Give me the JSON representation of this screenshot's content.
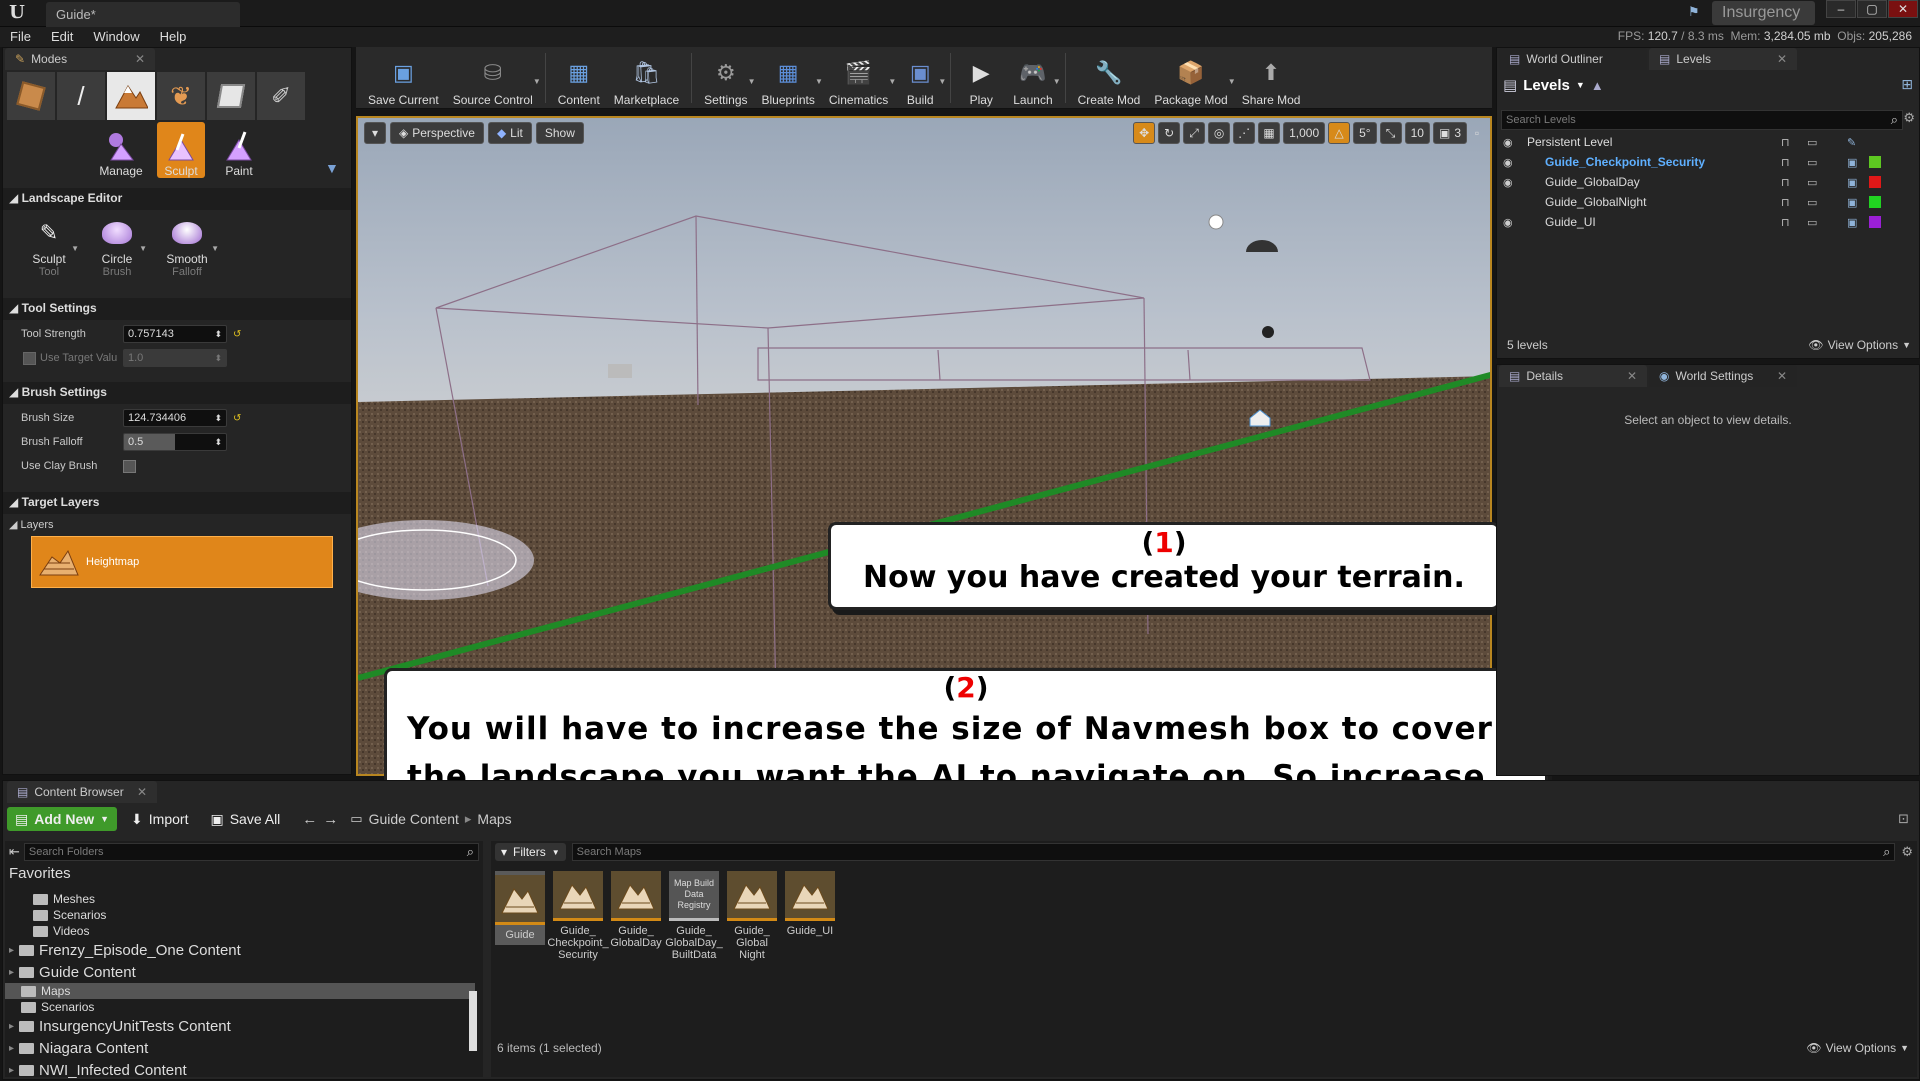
{
  "app": {
    "logo": "U",
    "doc_tab": "Guide*",
    "brand": "Insurgency",
    "window_controls": [
      "–",
      "▢",
      "✕"
    ]
  },
  "menu": [
    "File",
    "Edit",
    "Window",
    "Help"
  ],
  "stats": {
    "fps_label": "FPS:",
    "fps": "120.7",
    "ms": "/ 8.3 ms",
    "mem_label": "Mem:",
    "mem": "3,284.05 mb",
    "objs_label": "Objs:",
    "objs": "205,286"
  },
  "modes": {
    "tab": "Modes",
    "mode_icons": [
      "place-icon",
      "paint-brush-icon",
      "landscape-icon",
      "foliage-icon",
      "geometry-icon",
      "mesh-paint-icon"
    ],
    "landscape_tabs": [
      "Manage",
      "Sculpt",
      "Paint"
    ],
    "editor_title": "Landscape Editor",
    "tools": [
      {
        "label": "Sculpt",
        "sub": "Tool"
      },
      {
        "label": "Circle",
        "sub": "Brush"
      },
      {
        "label": "Smooth",
        "sub": "Falloff"
      }
    ],
    "tool_settings_title": "Tool Settings",
    "tool_strength_label": "Tool Strength",
    "tool_strength_value": "0.757143",
    "use_target_label": "Use Target Valu",
    "use_target_value": "1.0",
    "brush_settings_title": "Brush Settings",
    "brush_size_label": "Brush Size",
    "brush_size_value": "124.734406",
    "brush_falloff_label": "Brush Falloff",
    "brush_falloff_value": "0.5",
    "clay_label": "Use Clay Brush",
    "target_layers_title": "Target Layers",
    "layers_label": "Layers",
    "heightmap_label": "Heightmap"
  },
  "toolbar": [
    {
      "label": "Save Current",
      "icon": "save-icon"
    },
    {
      "label": "Source Control",
      "icon": "source-control-icon"
    },
    {
      "label": "Content",
      "icon": "content-icon"
    },
    {
      "label": "Marketplace",
      "icon": "marketplace-icon"
    },
    {
      "label": "Settings",
      "icon": "settings-icon"
    },
    {
      "label": "Blueprints",
      "icon": "blueprints-icon"
    },
    {
      "label": "Cinematics",
      "icon": "cinematics-icon"
    },
    {
      "label": "Build",
      "icon": "build-icon"
    },
    {
      "label": "Play",
      "icon": "play-icon"
    },
    {
      "label": "Launch",
      "icon": "launch-icon"
    },
    {
      "label": "Create Mod",
      "icon": "create-mod-icon"
    },
    {
      "label": "Package Mod",
      "icon": "package-mod-icon"
    },
    {
      "label": "Share Mod",
      "icon": "share-mod-icon"
    }
  ],
  "viewport": {
    "perspective": "Perspective",
    "lit": "Lit",
    "show": "Show",
    "grid_snap": "1,000",
    "rot_snap": "5°",
    "scale_snap": "10",
    "cam_speed": "3"
  },
  "outliner": {
    "tabs": [
      "World Outliner",
      "Levels"
    ],
    "levels_button": "Levels",
    "search_placeholder": "Search Levels",
    "items": [
      {
        "name": "Persistent Level",
        "color": "",
        "highlight": false
      },
      {
        "name": "Guide_Checkpoint_Security",
        "color": "#5dc821",
        "highlight": true
      },
      {
        "name": "Guide_GlobalDay",
        "color": "#e01818",
        "highlight": false
      },
      {
        "name": "Guide_GlobalNight",
        "color": "#21d321",
        "highlight": false
      },
      {
        "name": "Guide_UI",
        "color": "#9b1fd6",
        "highlight": false
      }
    ],
    "count": "5 levels",
    "view_options": "View Options"
  },
  "details": {
    "tabs": [
      "Details",
      "World Settings"
    ],
    "empty_text": "Select an object to view details."
  },
  "content_browser": {
    "tab": "Content Browser",
    "add_new": "Add New",
    "import": "Import",
    "save_all": "Save All",
    "path": [
      "Guide Content",
      "Maps"
    ],
    "search_folders": "Search Folders",
    "favorites": "Favorites",
    "folders": [
      {
        "name": "Meshes",
        "indent": 2,
        "selected": false,
        "large": false
      },
      {
        "name": "Scenarios",
        "indent": 2,
        "selected": false,
        "large": false
      },
      {
        "name": "Videos",
        "indent": 2,
        "selected": false,
        "large": false
      },
      {
        "name": "Frenzy_Episode_One Content",
        "indent": 0,
        "selected": false,
        "large": true
      },
      {
        "name": "Guide Content",
        "indent": 0,
        "selected": false,
        "large": true
      },
      {
        "name": "Maps",
        "indent": 1,
        "selected": true,
        "large": false
      },
      {
        "name": "Scenarios",
        "indent": 1,
        "selected": false,
        "large": false
      },
      {
        "name": "InsurgencyUnitTests Content",
        "indent": 0,
        "selected": false,
        "large": true
      },
      {
        "name": "Niagara Content",
        "indent": 0,
        "selected": false,
        "large": true
      },
      {
        "name": "NWI_Infected Content",
        "indent": 0,
        "selected": false,
        "large": true
      }
    ],
    "filters": "Filters",
    "search_maps": "Search Maps",
    "assets": [
      {
        "name": "Guide",
        "selected": true,
        "type": "map"
      },
      {
        "name": "Guide_ Checkpoint_ Security",
        "selected": false,
        "type": "map"
      },
      {
        "name": "Guide_ GlobalDay",
        "selected": false,
        "type": "map"
      },
      {
        "name": "Guide_ GlobalDay_ BuiltData",
        "selected": false,
        "type": "data",
        "thumb_text": "Map Build Data Registry"
      },
      {
        "name": "Guide_ Global Night",
        "selected": false,
        "type": "map"
      },
      {
        "name": "Guide_UI",
        "selected": false,
        "type": "map"
      }
    ],
    "status": "6 items (1 selected)",
    "view_options": "View Options"
  },
  "callouts": {
    "one_num": "1",
    "one_text": "Now you have created your terrain.",
    "two_num": "2",
    "two_text": "You will have to increase the size of Navmesh box to cover the landscape you want the AI to navigate on. So increase it."
  }
}
